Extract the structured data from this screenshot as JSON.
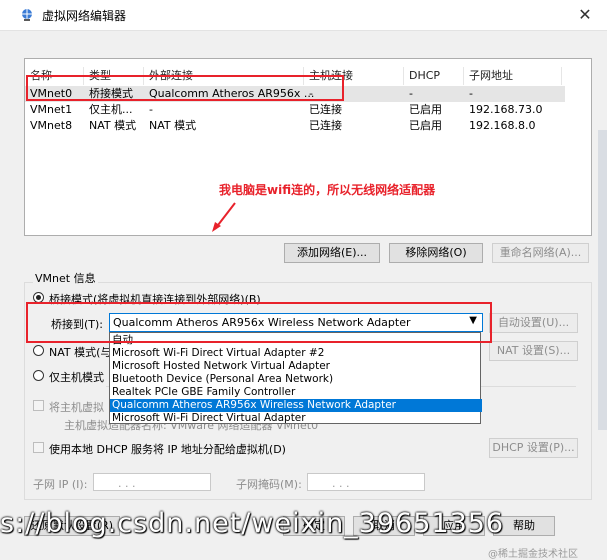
{
  "window": {
    "title": "虚拟网络编辑器",
    "close_glyph": "✕"
  },
  "table": {
    "headers": [
      "名称",
      "类型",
      "外部连接",
      "主机连接",
      "DHCP",
      "子网地址"
    ],
    "rows": [
      [
        "VMnet0",
        "桥接模式",
        "Qualcomm Atheros AR956x ...",
        "-",
        "-",
        "-"
      ],
      [
        "VMnet1",
        "仅主机...",
        "-",
        "已连接",
        "已启用",
        "192.168.73.0"
      ],
      [
        "VMnet8",
        "NAT 模式",
        "NAT 模式",
        "已连接",
        "已启用",
        "192.168.8.0"
      ]
    ]
  },
  "annotation": "我电脑是wifi连的，所以无线网络适配器",
  "buttons": {
    "add": "添加网络(E)...",
    "remove": "移除网络(O)",
    "rename": "重命名网络(A)..."
  },
  "vmnet_info": {
    "label": "VMnet 信息",
    "bridged": "桥接模式(将虚拟机直接连接到外部网络)(B)",
    "bridge_to": "桥接到(T):",
    "bridge_selected": "Qualcomm Atheros AR956x Wireless Network Adapter",
    "auto_setting": "自动设置(U)...",
    "nat": "NAT 模式(与",
    "nat_setting": "NAT 设置(S)...",
    "host_only": "仅主机模式",
    "connect_host": "将主机虚拟",
    "host_adapter_name": "主机虚拟适配器名称: VMware 网络适配器 VMnet0",
    "dhcp": "使用本地 DHCP 服务将 IP 地址分配给虚拟机(D)",
    "dhcp_setting": "DHCP 设置(P)...",
    "subnet_ip": "子网 IP (I):",
    "subnet_mask": "子网掩码(M):",
    "ip_placeholder": ".   .   ."
  },
  "dropdown": {
    "options": [
      "自动",
      "Microsoft Wi-Fi Direct Virtual Adapter #2",
      "Microsoft Hosted Network Virtual Adapter",
      "Bluetooth Device (Personal Area Network)",
      "Realtek PCIe GBE Family Controller",
      "Qualcomm Atheros AR956x Wireless Network Adapter",
      "Microsoft Wi-Fi Direct Virtual Adapter"
    ]
  },
  "bottom_buttons": {
    "restore": "还原默认设置(R)",
    "ok": "确定",
    "cancel": "取消",
    "apply": "应用",
    "help": "帮助"
  },
  "overlay_text": "s://blog.csdn.net/weixin_39651356",
  "watermark": "@稀土掘金技术社区",
  "colors": {
    "annotation_red": "#e8222b",
    "select_blue": "#0078d7"
  }
}
